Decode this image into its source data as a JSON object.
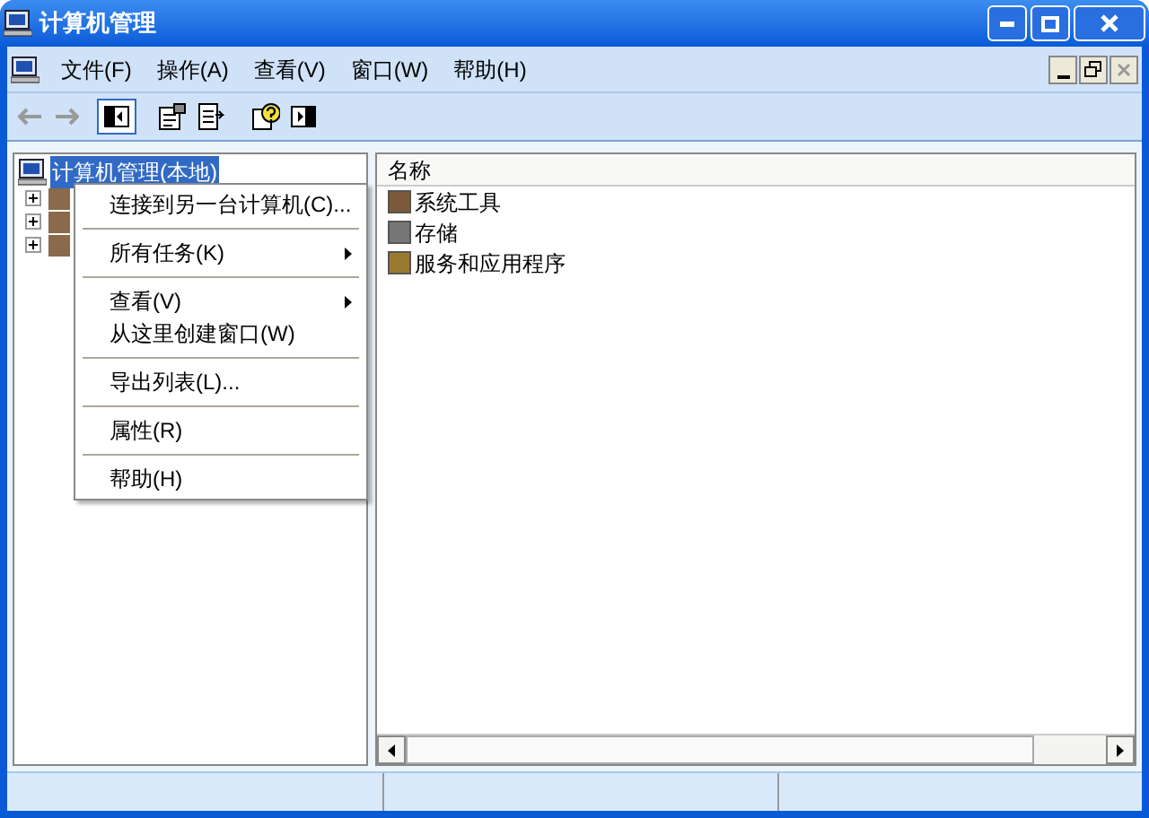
{
  "window": {
    "title": "计算机管理"
  },
  "menu_bar": [
    "文件(F)",
    "操作(A)",
    "查看(V)",
    "窗口(W)",
    "帮助(H)"
  ],
  "tree": {
    "root": {
      "label": "计算机管理(本地)",
      "selected": true
    },
    "items": [
      {
        "expanded": false
      },
      {
        "expanded": false
      },
      {
        "expanded": false
      }
    ]
  },
  "list": {
    "columns": [
      "名称"
    ],
    "rows": [
      "系统工具",
      "存储",
      "服务和应用程序"
    ]
  },
  "context_menu": [
    {
      "kind": "item",
      "label": "连接到另一台计算机(C)...",
      "submenu": false
    },
    {
      "kind": "separator"
    },
    {
      "kind": "item",
      "label": "所有任务(K)",
      "submenu": true
    },
    {
      "kind": "separator"
    },
    {
      "kind": "item",
      "label": "查看(V)",
      "submenu": true
    },
    {
      "kind": "item",
      "label": "从这里创建窗口(W)",
      "submenu": false
    },
    {
      "kind": "separator"
    },
    {
      "kind": "item",
      "label": "导出列表(L)...",
      "submenu": false
    },
    {
      "kind": "separator"
    },
    {
      "kind": "item",
      "label": "属性(R)",
      "submenu": false
    },
    {
      "kind": "separator"
    },
    {
      "kind": "item",
      "label": "帮助(H)",
      "submenu": false
    }
  ]
}
